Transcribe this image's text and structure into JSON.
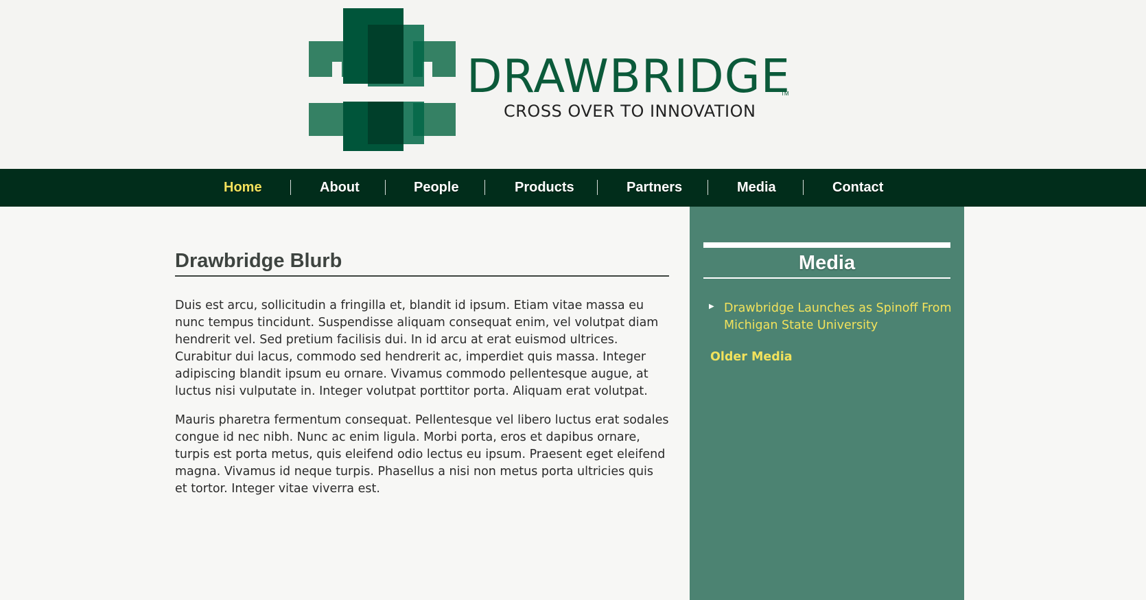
{
  "header": {
    "brand_name": "DRAWBRIDGE",
    "trademark": "TM",
    "tagline": "CROSS OVER TO INNOVATION"
  },
  "nav": {
    "items": [
      {
        "label": "Home",
        "active": true
      },
      {
        "label": "About",
        "active": false
      },
      {
        "label": "People",
        "active": false
      },
      {
        "label": "Products",
        "active": false
      },
      {
        "label": "Partners",
        "active": false
      },
      {
        "label": "Media",
        "active": false
      },
      {
        "label": "Contact",
        "active": false
      }
    ]
  },
  "main": {
    "title": "Drawbridge Blurb",
    "paragraphs": [
      "Duis est arcu, sollicitudin a fringilla et, blandit id ipsum. Etiam vitae massa eu nunc tempus tincidunt. Suspendisse aliquam consequat enim, vel volutpat diam hendrerit vel. Sed pretium facilisis dui. In id arcu at erat euismod ultrices. Curabitur dui lacus, commodo sed hendrerit ac, imperdiet quis massa. Integer adipiscing blandit ipsum eu ornare. Vivamus commodo pellentesque augue, at luctus nisi vulputate in. Integer volutpat porttitor porta. Aliquam erat volutpat.",
      "Mauris pharetra fermentum consequat. Pellentesque vel libero luctus erat sodales congue id nec nibh. Nunc ac enim ligula. Morbi porta, eros et dapibus ornare, turpis est porta metus, quis eleifend odio lectus eu ipsum. Praesent eget eleifend magna. Vivamus id neque turpis. Phasellus a nisi non metus porta ultricies quis et tortor. Integer vitae viverra est."
    ]
  },
  "sidebar": {
    "title": "Media",
    "items": [
      {
        "label": "Drawbridge Launches as Spinoff From Michigan State University"
      }
    ],
    "older_label": "Older Media"
  },
  "colors": {
    "brand_green": "#0b5a3a",
    "nav_bg": "#012d1b",
    "accent_yellow": "#f2e25c",
    "sidebar_bg": "#4c8372"
  }
}
